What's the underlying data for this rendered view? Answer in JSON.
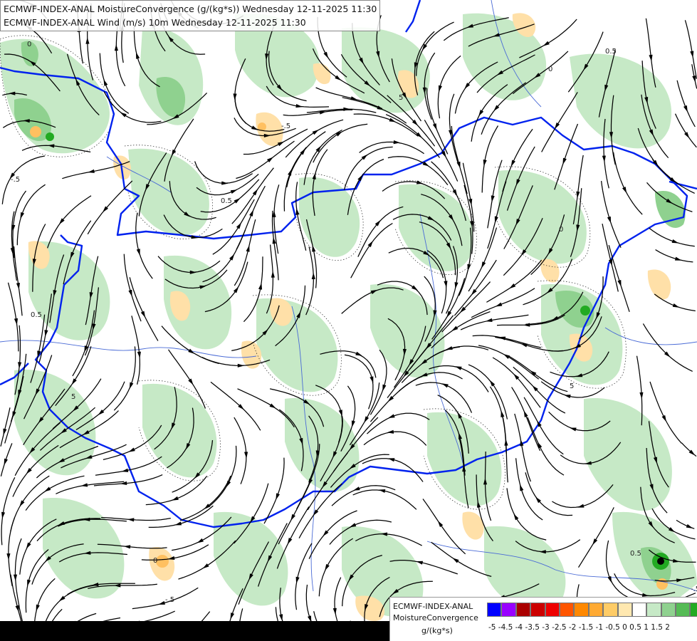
{
  "header": {
    "line1": "ECMWF-INDEX-ANAL MoistureConvergence (g/(kg*s)) Wednesday 12-11-2025 11:30",
    "line2": "ECMWF-INDEX-ANAL Wind (m/s) 10m Wednesday 12-11-2025 11:30"
  },
  "legend": {
    "line1": "ECMWF-INDEX-ANAL",
    "line2": "MoistureConvergence",
    "line3": "g/(kg*s)",
    "bins": [
      {
        "label": "-5",
        "color": "#0000ff"
      },
      {
        "label": "-4.5",
        "color": "#9900ff"
      },
      {
        "label": "-4",
        "color": "#aa0000"
      },
      {
        "label": "-3.5",
        "color": "#cc0000"
      },
      {
        "label": "-3",
        "color": "#ee0000"
      },
      {
        "label": "-2.5",
        "color": "#ff5500"
      },
      {
        "label": "-2",
        "color": "#ff8800"
      },
      {
        "label": "-1.5",
        "color": "#ffaa33"
      },
      {
        "label": "-1",
        "color": "#ffcc66"
      },
      {
        "label": "-0.5",
        "color": "#ffe8b0"
      },
      {
        "label": "0",
        "color": "#ffffff"
      },
      {
        "label": "0.5",
        "color": "#c6e9c6"
      },
      {
        "label": "1",
        "color": "#8fd18f"
      },
      {
        "label": "1.5",
        "color": "#55bb55"
      },
      {
        "label": "2",
        "color": "#22aa22"
      }
    ],
    "tick_text": "-5 -4.5 -4 -3.5 -3 -2.5 -2 -1.5 -1 -0.5  0  0.5  1  1.5  2"
  },
  "contour_labels": [
    "0",
    "0.5",
    "-.5",
    "5"
  ],
  "colors": {
    "border": "#0022ee",
    "river": "#4a6bd6",
    "streamline": "#000000",
    "convergence_light": "#c6e9c6",
    "convergence_mid": "#8fd18f",
    "convergence_strong": "#22aa22",
    "divergence_light": "#ffe0a8",
    "divergence_mid": "#ffc060"
  },
  "icons": {
    "streamline_arrow": "arrow-head-icon"
  }
}
